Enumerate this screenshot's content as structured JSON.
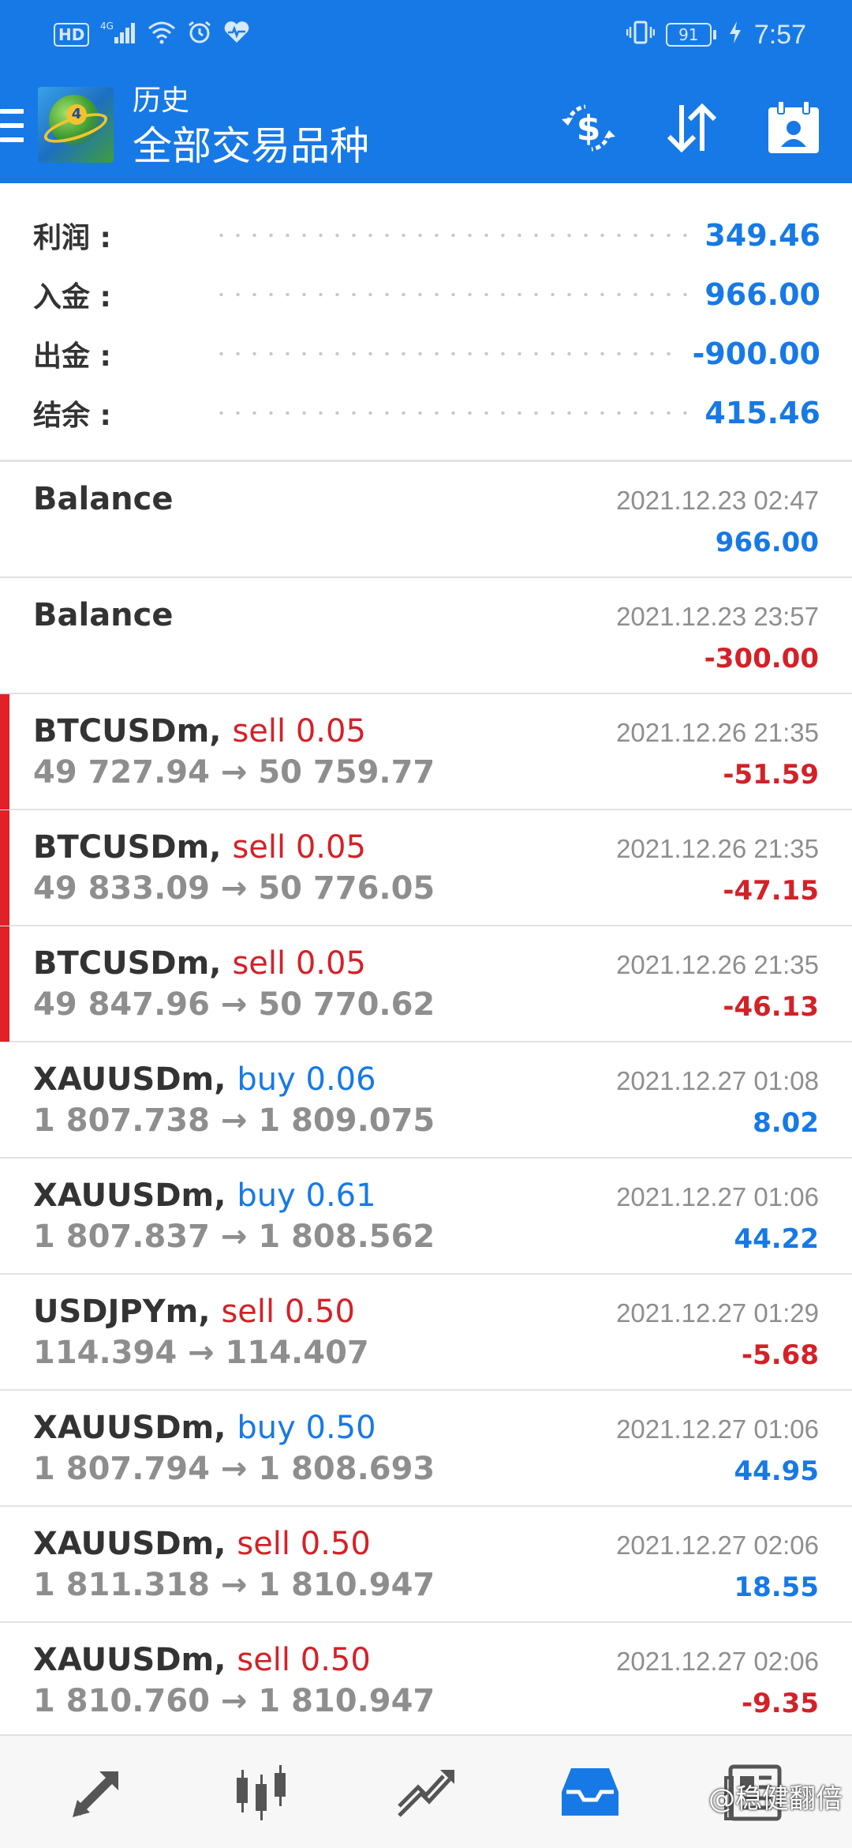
{
  "status_bar": {
    "hd": "HD",
    "signal": "4G",
    "battery": "91",
    "time": "7:57"
  },
  "app_bar": {
    "title_small": "历史",
    "title_large": "全部交易品种"
  },
  "summary": [
    {
      "label": "利润 :",
      "value": "349.46"
    },
    {
      "label": "入金 :",
      "value": "966.00"
    },
    {
      "label": "出金 :",
      "value": "-900.00"
    },
    {
      "label": "结余 :",
      "value": "415.46"
    }
  ],
  "history": [
    {
      "symbol": "Balance",
      "side": "",
      "prices": "",
      "time": "2021.12.23 02:47",
      "profit": "966.00"
    },
    {
      "symbol": "Balance",
      "side": "",
      "prices": "",
      "time": "2021.12.23 23:57",
      "profit": "-300.00"
    },
    {
      "symbol": "BTCUSDm,",
      "side": "sell 0.05",
      "prices": "49 727.94 → 50 759.77",
      "time": "2021.12.26 21:35",
      "profit": "-51.59"
    },
    {
      "symbol": "BTCUSDm,",
      "side": "sell 0.05",
      "prices": "49 833.09 → 50 776.05",
      "time": "2021.12.26 21:35",
      "profit": "-47.15"
    },
    {
      "symbol": "BTCUSDm,",
      "side": "sell 0.05",
      "prices": "49 847.96 → 50 770.62",
      "time": "2021.12.26 21:35",
      "profit": "-46.13"
    },
    {
      "symbol": "XAUUSDm,",
      "side": "buy 0.06",
      "prices": "1 807.738 → 1 809.075",
      "time": "2021.12.27 01:08",
      "profit": "8.02"
    },
    {
      "symbol": "XAUUSDm,",
      "side": "buy 0.61",
      "prices": "1 807.837 → 1 808.562",
      "time": "2021.12.27 01:06",
      "profit": "44.22"
    },
    {
      "symbol": "USDJPYm,",
      "side": "sell 0.50",
      "prices": "114.394 → 114.407",
      "time": "2021.12.27 01:29",
      "profit": "-5.68"
    },
    {
      "symbol": "XAUUSDm,",
      "side": "buy 0.50",
      "prices": "1 807.794 → 1 808.693",
      "time": "2021.12.27 01:06",
      "profit": "44.95"
    },
    {
      "symbol": "XAUUSDm,",
      "side": "sell 0.50",
      "prices": "1 811.318 → 1 810.947",
      "time": "2021.12.27 02:06",
      "profit": "18.55"
    },
    {
      "symbol": "XAUUSDm,",
      "side": "sell 0.50",
      "prices": "1 810.760 → 1 810.947",
      "time": "2021.12.27 02:06",
      "profit": "-9.35"
    }
  ],
  "bottom_nav": [
    {
      "name": "quotes",
      "icon": "quotes-arrows-icon"
    },
    {
      "name": "charts",
      "icon": "candlestick-icon"
    },
    {
      "name": "trade",
      "icon": "trade-chart-icon"
    },
    {
      "name": "history",
      "icon": "inbox-icon"
    },
    {
      "name": "news",
      "icon": "newspaper-icon"
    }
  ],
  "watermark": "@稳健翻倍",
  "colors": {
    "brand_blue": "#1779e6",
    "sell_red": "#d42128",
    "marker_red": "#e02126",
    "muted_gray": "#8e8e8e"
  }
}
